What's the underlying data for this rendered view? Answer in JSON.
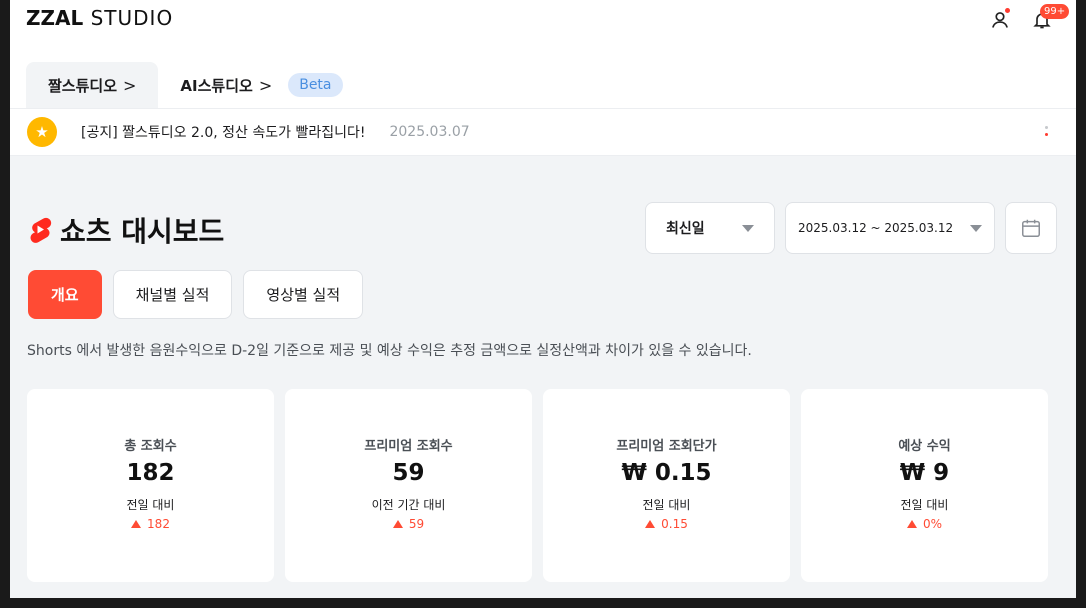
{
  "header": {
    "logo_strong": "ZZAL",
    "logo_rest": "STUDIO",
    "notification_badge": "99+"
  },
  "studio_tabs": [
    {
      "label": "짤스튜디오",
      "chevron": ">",
      "active": true
    },
    {
      "label": "AI스튜디오",
      "chevron": ">",
      "active": false,
      "badge": "Beta"
    }
  ],
  "notice": {
    "text": "[공지] 짤스튜디오 2.0, 정산 속도가 빨라집니다!",
    "date": "2025.03.07"
  },
  "dashboard": {
    "title": "쇼츠 대시보드",
    "sort_label": "최신일",
    "date_range": "2025.03.12 ~ 2025.03.12"
  },
  "view_tabs": [
    {
      "label": "개요",
      "active": true
    },
    {
      "label": "채널별 실적",
      "active": false
    },
    {
      "label": "영상별 실적",
      "active": false
    }
  ],
  "description": "Shorts 에서 발생한 음원수익으로 D-2일 기준으로 제공 및 예상 수익은 추정 금액으로 실정산액과 차이가 있을 수 있습니다.",
  "metrics": [
    {
      "label": "총 조회수",
      "value": "182",
      "compare_label": "전일 대비",
      "delta": "182"
    },
    {
      "label": "프리미엄 조회수",
      "value": "59",
      "compare_label": "이전 기간 대비",
      "delta": "59"
    },
    {
      "label": "프리미엄 조회단가",
      "value": "₩ 0.15",
      "compare_label": "전일 대비",
      "delta": "0.15"
    },
    {
      "label": "예상 수익",
      "value": "₩ 9",
      "compare_label": "전일 대비",
      "delta": "0%"
    }
  ],
  "colors": {
    "accent": "#ff4b34",
    "notice_star": "#ffb800",
    "beta_bg": "#dbe8fb",
    "beta_text": "#4a8fe0",
    "page_bg": "#f2f4f6"
  },
  "icons": {
    "user": "user-icon",
    "bell": "bell-icon",
    "star": "star-icon",
    "kebab": "kebab-menu-icon",
    "shorts": "youtube-shorts-icon",
    "calendar": "calendar-icon",
    "dropdown": "caret-down-icon",
    "trend": "arrow-up-icon"
  }
}
